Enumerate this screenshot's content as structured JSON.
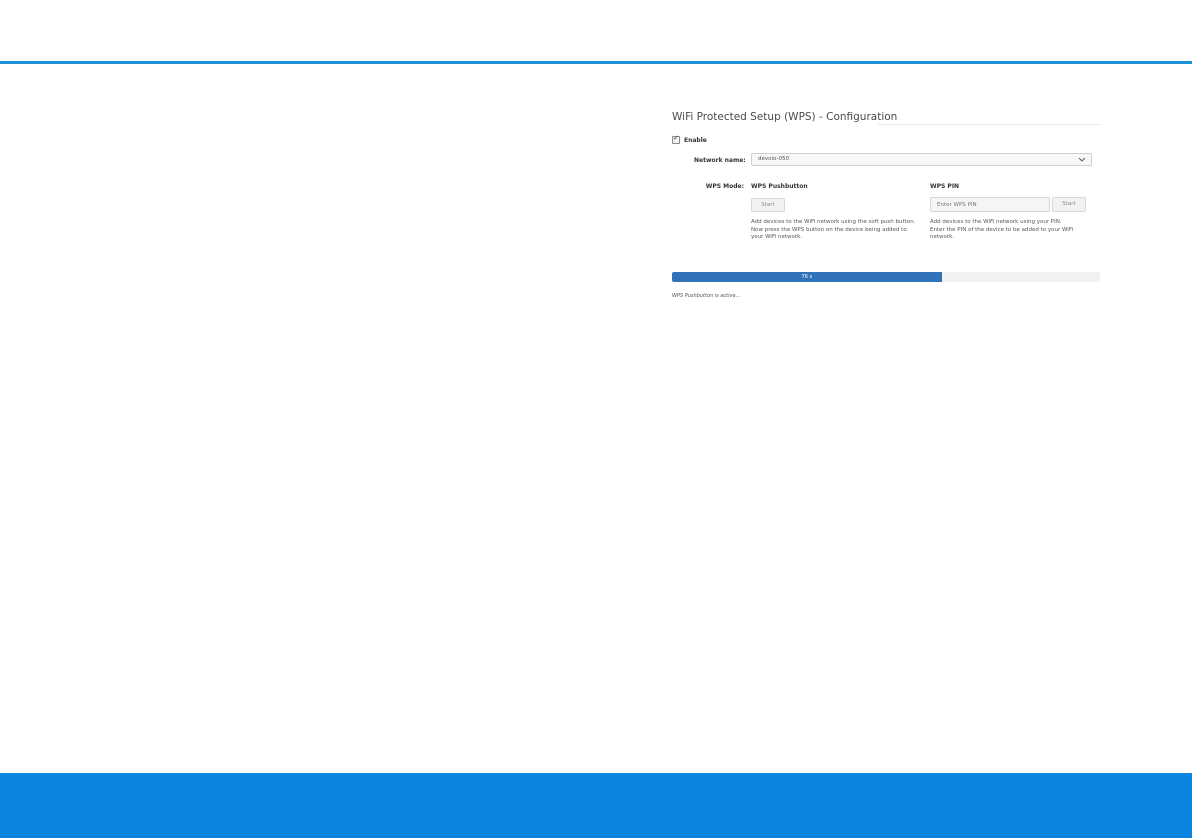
{
  "header": {
    "accent_color": "#1e90d6"
  },
  "footer": {
    "band_color": "#0a85e0"
  },
  "wps": {
    "title": "WiFi Protected Setup (WPS) - Configuration",
    "enable": {
      "label": "Enable",
      "checked": true
    },
    "network_name": {
      "label": "Network name:",
      "value": "devolo-050"
    },
    "mode_label": "WPS Mode:",
    "pushbutton": {
      "title": "WPS Pushbutton",
      "start_label": "Start",
      "help_line1": "Add devices to the WiFi network using the soft push button.",
      "help_line2": "Now press the WPS button on the device being added to your WiFi network."
    },
    "pin": {
      "title": "WPS PIN",
      "placeholder": "Enter WPS PIN",
      "start_label": "Start",
      "help_line1": "Add devices to the WiFi network using your PIN.",
      "help_line2": "Enter the PIN of the device to be added to your WiFi network."
    },
    "progress": {
      "label": "76 s",
      "fraction": 0.63,
      "color": "#3073b8"
    },
    "status": "WPS Pushbutton is active..."
  }
}
